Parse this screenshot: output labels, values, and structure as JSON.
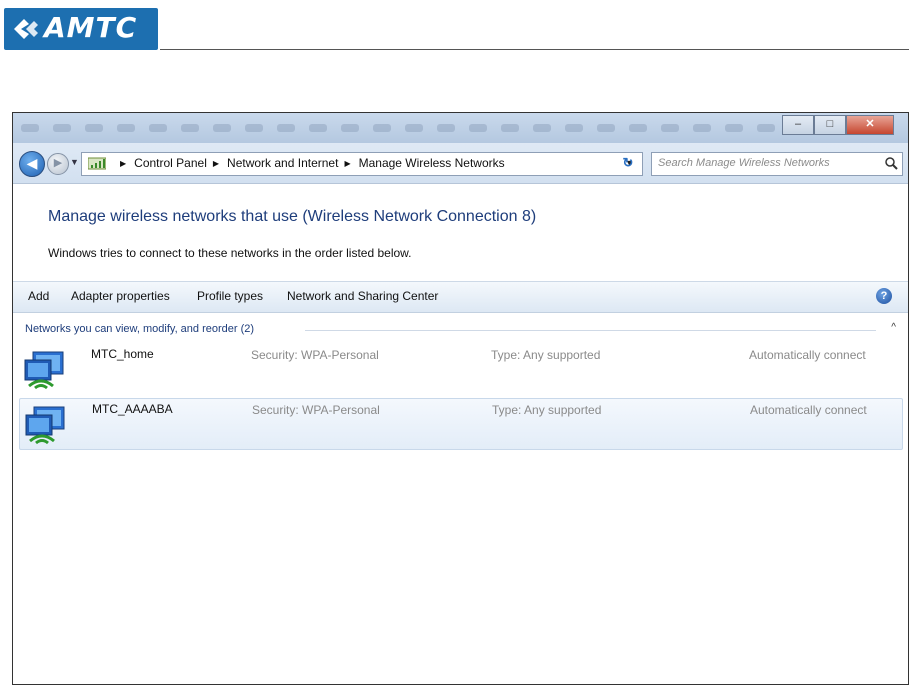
{
  "doc_header": {
    "logo_text": "AMTC"
  },
  "window": {
    "address": {
      "crumbs": [
        "Control Panel",
        "Network and Internet",
        "Manage Wireless Networks"
      ],
      "search_placeholder": "Search Manage Wireless Networks"
    },
    "heading": "Manage wireless networks that use (Wireless Network Connection 8)",
    "description": "Windows tries to connect to these networks in the order listed below.",
    "toolbar": {
      "add": "Add",
      "adapter_properties": "Adapter properties",
      "profile_types": "Profile types",
      "network_sharing_center": "Network and Sharing Center"
    },
    "group_label": "Networks you can view, modify, and reorder (2)",
    "networks": [
      {
        "name": "MTC_home",
        "security": "Security: WPA-Personal",
        "type": "Type: Any supported",
        "connect": "Automatically connect"
      },
      {
        "name": "MTC_AAAABA",
        "security": "Security: WPA-Personal",
        "type": "Type: Any supported",
        "connect": "Automatically connect"
      }
    ],
    "icons": {
      "back": "back-arrow-icon",
      "forward": "forward-arrow-icon",
      "refresh": "refresh-icon",
      "search": "search-icon",
      "help": "help-icon",
      "network": "wireless-network-icon"
    },
    "colors": {
      "accent": "#1e3d7b",
      "logo_bg": "#1d6fb0",
      "selected_row": "#e3edf8"
    }
  }
}
